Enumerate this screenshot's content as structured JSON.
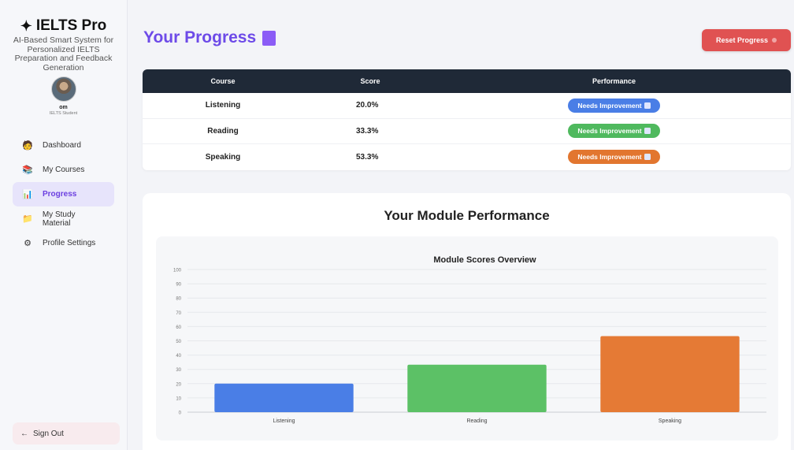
{
  "sidebar": {
    "brand_star": "✦",
    "brand_title": "IELTS Pro",
    "brand_subtitle": "AI-Based Smart System for Personalized IELTS Preparation and Feedback Generation",
    "user_name": "om",
    "user_role": "IELTS Student",
    "nav": [
      {
        "label": "Dashboard",
        "icon": "person-icon",
        "glyph": "🧑"
      },
      {
        "label": "My Courses",
        "icon": "books-icon",
        "glyph": "📚"
      },
      {
        "label": "Progress",
        "icon": "bar-chart-icon",
        "glyph": "📊"
      },
      {
        "label": "My Study Material",
        "icon": "folder-icon",
        "glyph": "📁"
      },
      {
        "label": "Profile Settings",
        "icon": "gear-icon",
        "glyph": "⚙"
      }
    ],
    "active_nav": "Progress",
    "signout_label": "Sign Out",
    "signout_glyph": "←"
  },
  "header": {
    "title": "Your Progress",
    "reset_label": "Reset Progress"
  },
  "table": {
    "headers": [
      "Course",
      "Score",
      "Performance"
    ],
    "rows": [
      {
        "course": "Listening",
        "score": "20.0%",
        "performance": "Needs Improvement",
        "color": "#4a7ee6"
      },
      {
        "course": "Reading",
        "score": "33.3%",
        "performance": "Needs Improvement",
        "color": "#4fb95e"
      },
      {
        "course": "Speaking",
        "score": "53.3%",
        "performance": "Needs Improvement",
        "color": "#e2762f"
      }
    ]
  },
  "chart_section": {
    "heading": "Your Module Performance"
  },
  "colors": {
    "accent": "#6d4ae8",
    "reset": "#e05252"
  },
  "chart_data": {
    "type": "bar",
    "title": "Module Scores Overview",
    "categories": [
      "Listening",
      "Reading",
      "Speaking"
    ],
    "values": [
      20.0,
      33.3,
      53.3
    ],
    "colors": [
      "#4a7ee6",
      "#5cc166",
      "#e57a35"
    ],
    "ylim": [
      0,
      100
    ],
    "yticks": [
      0,
      10,
      20,
      30,
      40,
      50,
      60,
      70,
      80,
      90,
      100
    ],
    "xlabel": "",
    "ylabel": "",
    "grid": true
  }
}
